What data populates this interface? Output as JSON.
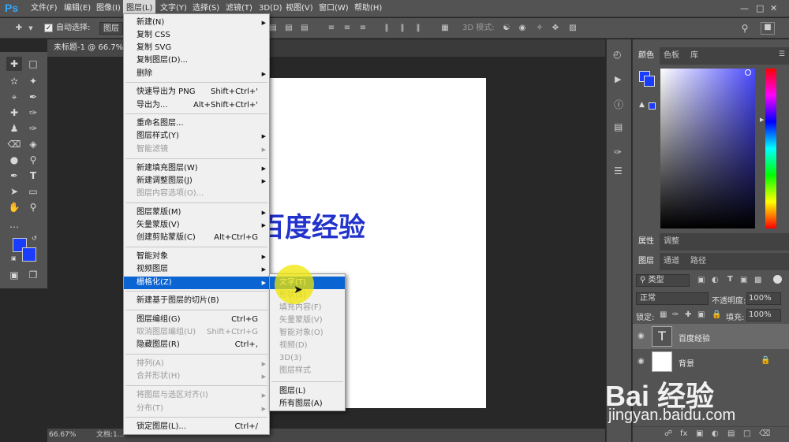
{
  "menubar": {
    "logo": "Ps",
    "items": [
      "文件(F)",
      "编辑(E)",
      "图像(I)",
      "图层(L)",
      "文字(Y)",
      "选择(S)",
      "滤镜(T)",
      "3D(D)",
      "视图(V)",
      "窗口(W)",
      "帮助(H)"
    ]
  },
  "options": {
    "auto_select_label": "自动选择:",
    "auto_select_value": "图层",
    "mode_3d_label": "3D 模式:"
  },
  "document": {
    "tab_title": "未标题-1 @ 66.7% (",
    "text": "百度经验",
    "status_zoom": "66.67%",
    "status_doc": "文档:1..."
  },
  "layer_menu": {
    "items": [
      {
        "label": "新建(N)",
        "shortcut": "",
        "sub": true,
        "disabled": false
      },
      {
        "label": "复制 CSS",
        "shortcut": "",
        "sub": false,
        "disabled": false
      },
      {
        "label": "复制 SVG",
        "shortcut": "",
        "sub": false,
        "disabled": false
      },
      {
        "label": "复制图层(D)...",
        "shortcut": "",
        "sub": false,
        "disabled": false
      },
      {
        "label": "删除",
        "shortcut": "",
        "sub": true,
        "disabled": false
      },
      {
        "label": "快速导出为 PNG",
        "shortcut": "Shift+Ctrl+'",
        "sub": false,
        "disabled": false
      },
      {
        "label": "导出为...",
        "shortcut": "Alt+Shift+Ctrl+'",
        "sub": false,
        "disabled": false
      },
      {
        "label": "重命名图层...",
        "shortcut": "",
        "sub": false,
        "disabled": false
      },
      {
        "label": "图层样式(Y)",
        "shortcut": "",
        "sub": true,
        "disabled": false
      },
      {
        "label": "智能滤镜",
        "shortcut": "",
        "sub": true,
        "disabled": true
      },
      {
        "label": "新建填充图层(W)",
        "shortcut": "",
        "sub": true,
        "disabled": false
      },
      {
        "label": "新建调整图层(J)",
        "shortcut": "",
        "sub": true,
        "disabled": false
      },
      {
        "label": "图层内容选项(O)...",
        "shortcut": "",
        "sub": false,
        "disabled": true
      },
      {
        "label": "图层蒙版(M)",
        "shortcut": "",
        "sub": true,
        "disabled": false
      },
      {
        "label": "矢量蒙版(V)",
        "shortcut": "",
        "sub": true,
        "disabled": false
      },
      {
        "label": "创建剪贴蒙版(C)",
        "shortcut": "Alt+Ctrl+G",
        "sub": false,
        "disabled": false
      },
      {
        "label": "智能对象",
        "shortcut": "",
        "sub": true,
        "disabled": false
      },
      {
        "label": "视频图层",
        "shortcut": "",
        "sub": true,
        "disabled": false
      },
      {
        "label": "栅格化(Z)",
        "shortcut": "",
        "sub": true,
        "disabled": false,
        "highlight": true
      },
      {
        "label": "新建基于图层的切片(B)",
        "shortcut": "",
        "sub": false,
        "disabled": false
      },
      {
        "label": "图层编组(G)",
        "shortcut": "Ctrl+G",
        "sub": false,
        "disabled": false
      },
      {
        "label": "取消图层编组(U)",
        "shortcut": "Shift+Ctrl+G",
        "sub": false,
        "disabled": true
      },
      {
        "label": "隐藏图层(R)",
        "shortcut": "Ctrl+,",
        "sub": false,
        "disabled": false
      },
      {
        "label": "排列(A)",
        "shortcut": "",
        "sub": true,
        "disabled": true
      },
      {
        "label": "合并形状(H)",
        "shortcut": "",
        "sub": true,
        "disabled": true
      },
      {
        "label": "将图层与选区对齐(I)",
        "shortcut": "",
        "sub": true,
        "disabled": true
      },
      {
        "label": "分布(T)",
        "shortcut": "",
        "sub": true,
        "disabled": true
      },
      {
        "label": "锁定图层(L)...",
        "shortcut": "Ctrl+/",
        "sub": false,
        "disabled": false
      }
    ]
  },
  "rasterize_menu": {
    "items": [
      {
        "label": "文字(T)",
        "disabled": false,
        "highlight": true
      },
      {
        "label": "形状(S)",
        "disabled": true
      },
      {
        "label": "填充内容(F)",
        "disabled": true
      },
      {
        "label": "矢量蒙版(V)",
        "disabled": true
      },
      {
        "label": "智能对象(O)",
        "disabled": true
      },
      {
        "label": "视频(D)",
        "disabled": true
      },
      {
        "label": "3D(3)",
        "disabled": true
      },
      {
        "label": "图层样式",
        "disabled": true
      },
      {
        "label": "图层(L)",
        "disabled": false
      },
      {
        "label": "所有图层(A)",
        "disabled": false
      }
    ]
  },
  "panels": {
    "color_tabs": [
      "颜色",
      "色板",
      "库"
    ],
    "props_tabs": [
      "属性",
      "调整"
    ],
    "layers_tabs": [
      "图层",
      "通道",
      "路径"
    ],
    "filter_kind": "类型",
    "blend_mode": "正常",
    "opacity_label": "不透明度:",
    "opacity_value": "100%",
    "lock_label": "锁定:",
    "fill_label": "填充:",
    "fill_value": "100%",
    "layers": [
      {
        "name": "百度经验",
        "type": "text"
      },
      {
        "name": "背景",
        "type": "bg"
      }
    ]
  },
  "colors": {
    "foreground": "#1a3cff",
    "background": "#1a3cff",
    "menu_highlight": "#0a64d2"
  },
  "watermark": {
    "brand": "Bai 经验",
    "url": "jingyan.baidu.com"
  }
}
